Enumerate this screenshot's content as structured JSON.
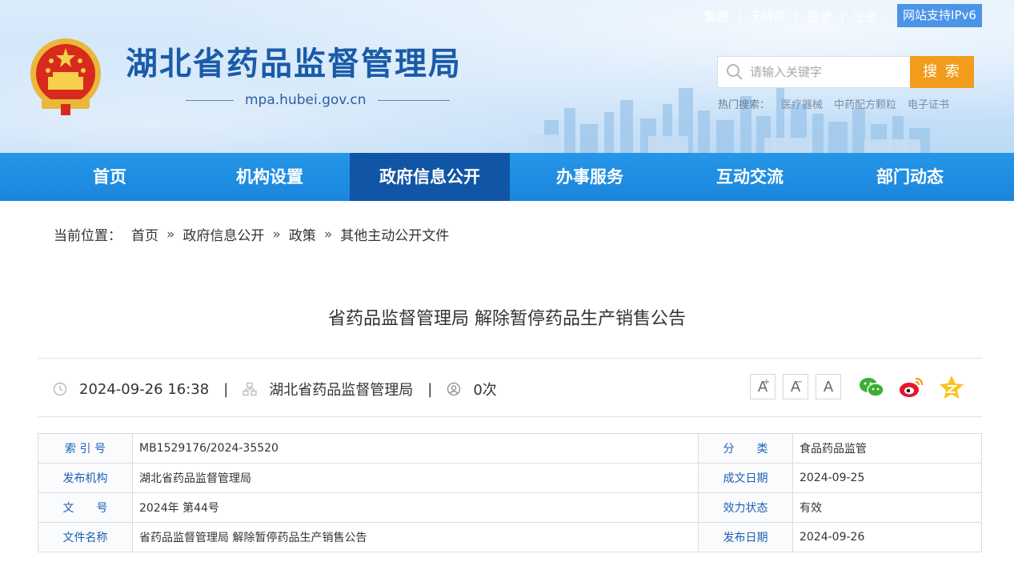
{
  "header": {
    "site_title": "湖北省药品监督管理局",
    "site_domain": "mpa.hubei.gov.cn",
    "top_links": [
      "繁體",
      "无障碍",
      "登录",
      "注册"
    ],
    "ipv6_label": "网站支持IPv6",
    "search": {
      "placeholder": "请输入关键字",
      "button_label": "搜 索"
    },
    "hot_search": {
      "label": "热门搜索：",
      "keywords": [
        "医疗器械",
        "中药配方颗粒",
        "电子证书"
      ]
    }
  },
  "nav": {
    "items": [
      {
        "label": "首页"
      },
      {
        "label": "机构设置"
      },
      {
        "label": "政府信息公开"
      },
      {
        "label": "办事服务"
      },
      {
        "label": "互动交流"
      },
      {
        "label": "部门动态"
      }
    ],
    "active_index": 2
  },
  "breadcrumb": {
    "lead": "当前位置：",
    "items": [
      "首页",
      "政府信息公开",
      "政策",
      "其他主动公开文件"
    ],
    "separator": "»"
  },
  "article": {
    "title": "省药品监督管理局 解除暂停药品生产销售公告",
    "datetime": "2024-09-26 16:38",
    "source": "湖北省药品监督管理局",
    "views": "0次",
    "font_sizes": [
      "A+",
      "A-",
      "A"
    ],
    "share_icons": [
      "wechat-icon",
      "weibo-icon",
      "qzone-icon"
    ]
  },
  "info": {
    "rows": [
      {
        "label1": "索 引 号",
        "value1": "MB1529176/2024-35520",
        "label2": "分　　类",
        "value2": "食品药品监管"
      },
      {
        "label1": "发布机构",
        "value1": "湖北省药品监督管理局",
        "label2": "成文日期",
        "value2": "2024-09-25"
      },
      {
        "label1": "文　　号",
        "value1": "2024年 第44号",
        "label2": "效力状态",
        "value2": "有效"
      },
      {
        "label1": "文件名称",
        "value1": "省药品监督管理局 解除暂停药品生产销售公告",
        "label2": "发布日期",
        "value2": "2024-09-26"
      }
    ]
  },
  "colors": {
    "nav_bg": "#1a86dc",
    "nav_active": "#1155a6",
    "title_blue": "#1a5ba8",
    "search_orange": "#f39b1c",
    "label_blue": "#1e5fb3"
  }
}
